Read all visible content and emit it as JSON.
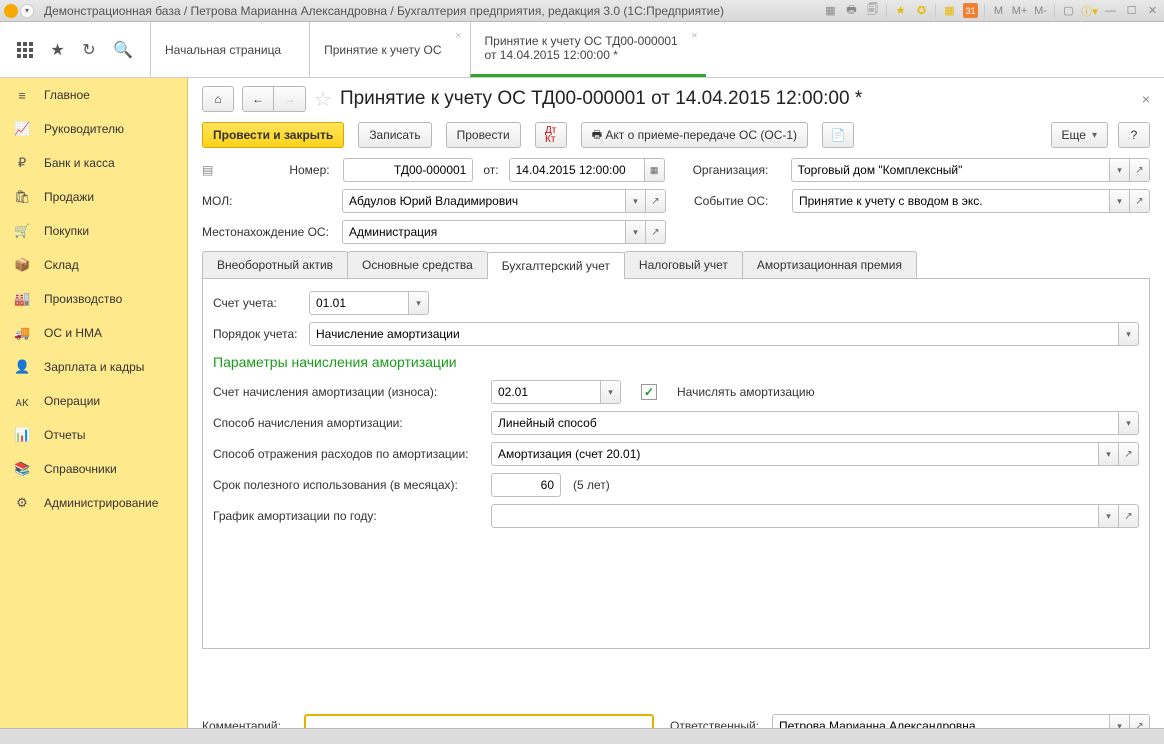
{
  "titlebar": {
    "text": "Демонстрационная база / Петрова Марианна Александровна / Бухгалтерия предприятия, редакция 3.0  (1С:Предприятие)"
  },
  "tabs_top": {
    "home": "Начальная страница",
    "t1": "Принятие к учету ОС",
    "t2_line1": "Принятие к учету ОС ТД00-000001",
    "t2_line2": "от 14.04.2015 12:00:00 *"
  },
  "sidebar": {
    "items": [
      {
        "icon": "≡",
        "label": "Главное"
      },
      {
        "icon": "📈",
        "label": "Руководителю"
      },
      {
        "icon": "₽",
        "label": "Банк и касса"
      },
      {
        "icon": "🛍",
        "label": "Продажи"
      },
      {
        "icon": "🛒",
        "label": "Покупки"
      },
      {
        "icon": "📦",
        "label": "Склад"
      },
      {
        "icon": "🏭",
        "label": "Производство"
      },
      {
        "icon": "🚚",
        "label": "ОС и НМА"
      },
      {
        "icon": "👤",
        "label": "Зарплата и кадры"
      },
      {
        "icon": "ᴀᴋ",
        "label": "Операции"
      },
      {
        "icon": "📊",
        "label": "Отчеты"
      },
      {
        "icon": "📚",
        "label": "Справочники"
      },
      {
        "icon": "⚙",
        "label": "Администрирование"
      }
    ]
  },
  "page": {
    "title": "Принятие к учету ОС ТД00-000001 от 14.04.2015 12:00:00 *"
  },
  "toolbar": {
    "post_close": "Провести и закрыть",
    "write": "Записать",
    "post": "Провести",
    "act": "Акт о приеме-передаче ОС (ОС-1)",
    "more": "Еще"
  },
  "form": {
    "number_label": "Номер:",
    "number": "ТД00-000001",
    "from_label": "от:",
    "date": "14.04.2015 12:00:00",
    "org_label": "Организация:",
    "org": "Торговый дом \"Комплексный\"",
    "mol_label": "МОЛ:",
    "mol": "Абдулов Юрий Владимирович",
    "event_label": "Событие ОС:",
    "event": "Принятие к учету с вводом в экс.",
    "loc_label": "Местонахождение ОС:",
    "loc": "Администрация"
  },
  "subtabs": {
    "t1": "Внеоборотный актив",
    "t2": "Основные средства",
    "t3": "Бухгалтерский учет",
    "t4": "Налоговый учет",
    "t5": "Амортизационная премия"
  },
  "acct": {
    "schet_label": "Счет учета:",
    "schet": "01.01",
    "poryadok_label": "Порядок учета:",
    "poryadok": "Начисление амортизации",
    "section": "Параметры начисления амортизации",
    "schet_am_label": "Счет начисления амортизации (износа):",
    "schet_am": "02.01",
    "calc_am": "Начислять амортизацию",
    "method_label": "Способ начисления амортизации:",
    "method": "Линейный способ",
    "expense_label": "Способ отражения расходов по амортизации:",
    "expense": "Амортизация (счет 20.01)",
    "life_label": "Срок полезного использования (в месяцах):",
    "life": "60",
    "life_hint": "(5 лет)",
    "graph_label": "График амортизации по году:",
    "graph": ""
  },
  "footer": {
    "comment_label": "Комментарий:",
    "comment": "",
    "resp_label": "Ответственный:",
    "resp": "Петрова Марианна Александровна"
  }
}
